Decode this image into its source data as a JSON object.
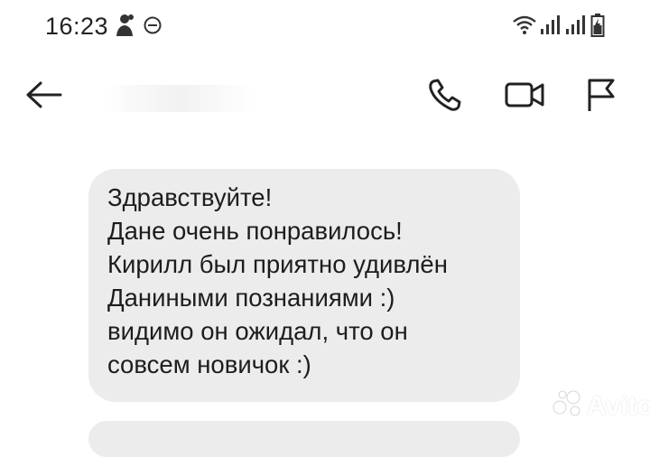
{
  "status_bar": {
    "time": "16:23",
    "icons": [
      "notification-person-icon",
      "do-not-disturb-icon",
      "wifi-icon",
      "signal-icon",
      "signal-icon",
      "battery-charging-icon"
    ]
  },
  "app_bar": {
    "icons": [
      "back-arrow-icon",
      "phone-icon",
      "video-icon",
      "flag-icon"
    ]
  },
  "conversation": {
    "messages": [
      {
        "lines": [
          "Здравствуйте!",
          "Дане очень понравилось!",
          "Кирилл был приятно удивлён",
          "Даниными познаниями :)",
          "видимо он ожидал, что он",
          "совсем новичок :)"
        ]
      }
    ]
  },
  "watermark": {
    "text": "Avito"
  }
}
